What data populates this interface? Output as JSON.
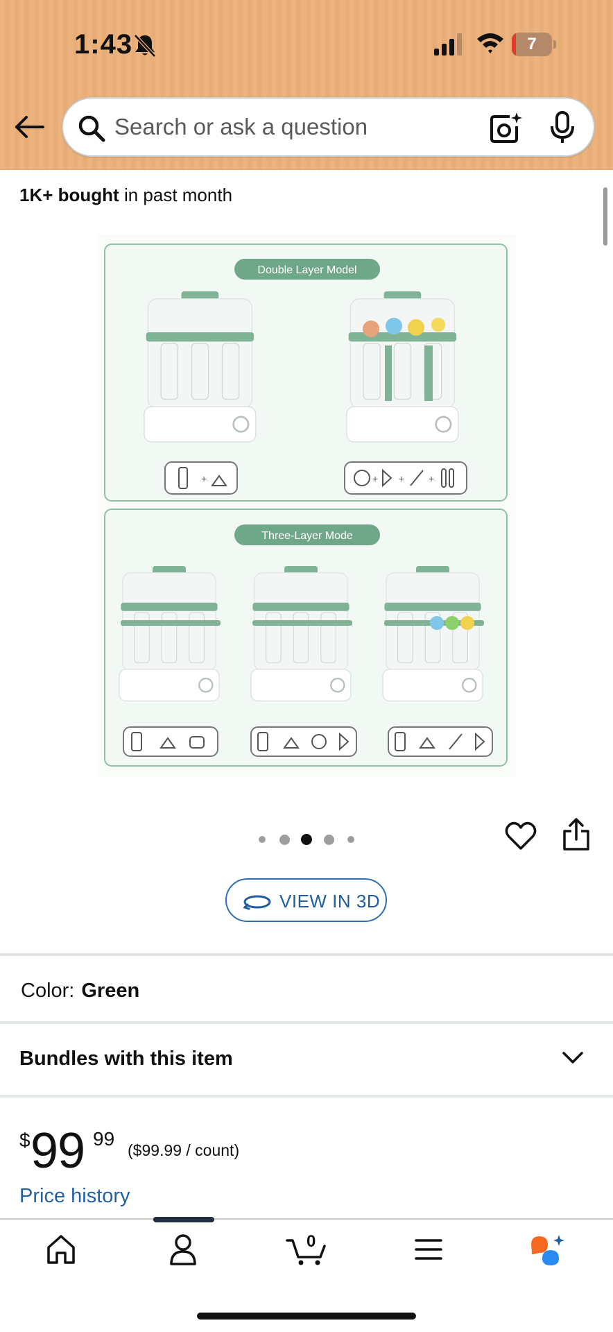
{
  "status_bar": {
    "time": "1:43",
    "battery_level": "7",
    "battery_fraction": 0.07
  },
  "search": {
    "placeholder": "Search or ask a question"
  },
  "product": {
    "bought_strong": "1K+ bought",
    "bought_rest": " in past month",
    "image_labels": {
      "double_layer": "Double Layer Model",
      "three_layer": "Three-Layer Mode"
    },
    "carousel": {
      "count": 5,
      "active_index": 2
    },
    "view_3d_label": "VIEW IN 3D",
    "color_label": "Color:",
    "color_value": "Green",
    "bundles_label": "Bundles with this item",
    "price": {
      "symbol": "$",
      "whole": "99",
      "fraction": "99",
      "unit": "($99.99 / count)"
    },
    "price_history_label": "Price history"
  },
  "bottom_nav": {
    "items": [
      "home-icon",
      "account-icon",
      "cart-icon",
      "menu-icon",
      "assistant-icon"
    ],
    "cart_count": "0"
  },
  "colors": {
    "header_bg": "#edb37e",
    "link_blue": "#2162a1",
    "accent_green": "#6fa888",
    "assistant_orange": "#f56a23",
    "assistant_blue": "#2a8cf0"
  }
}
